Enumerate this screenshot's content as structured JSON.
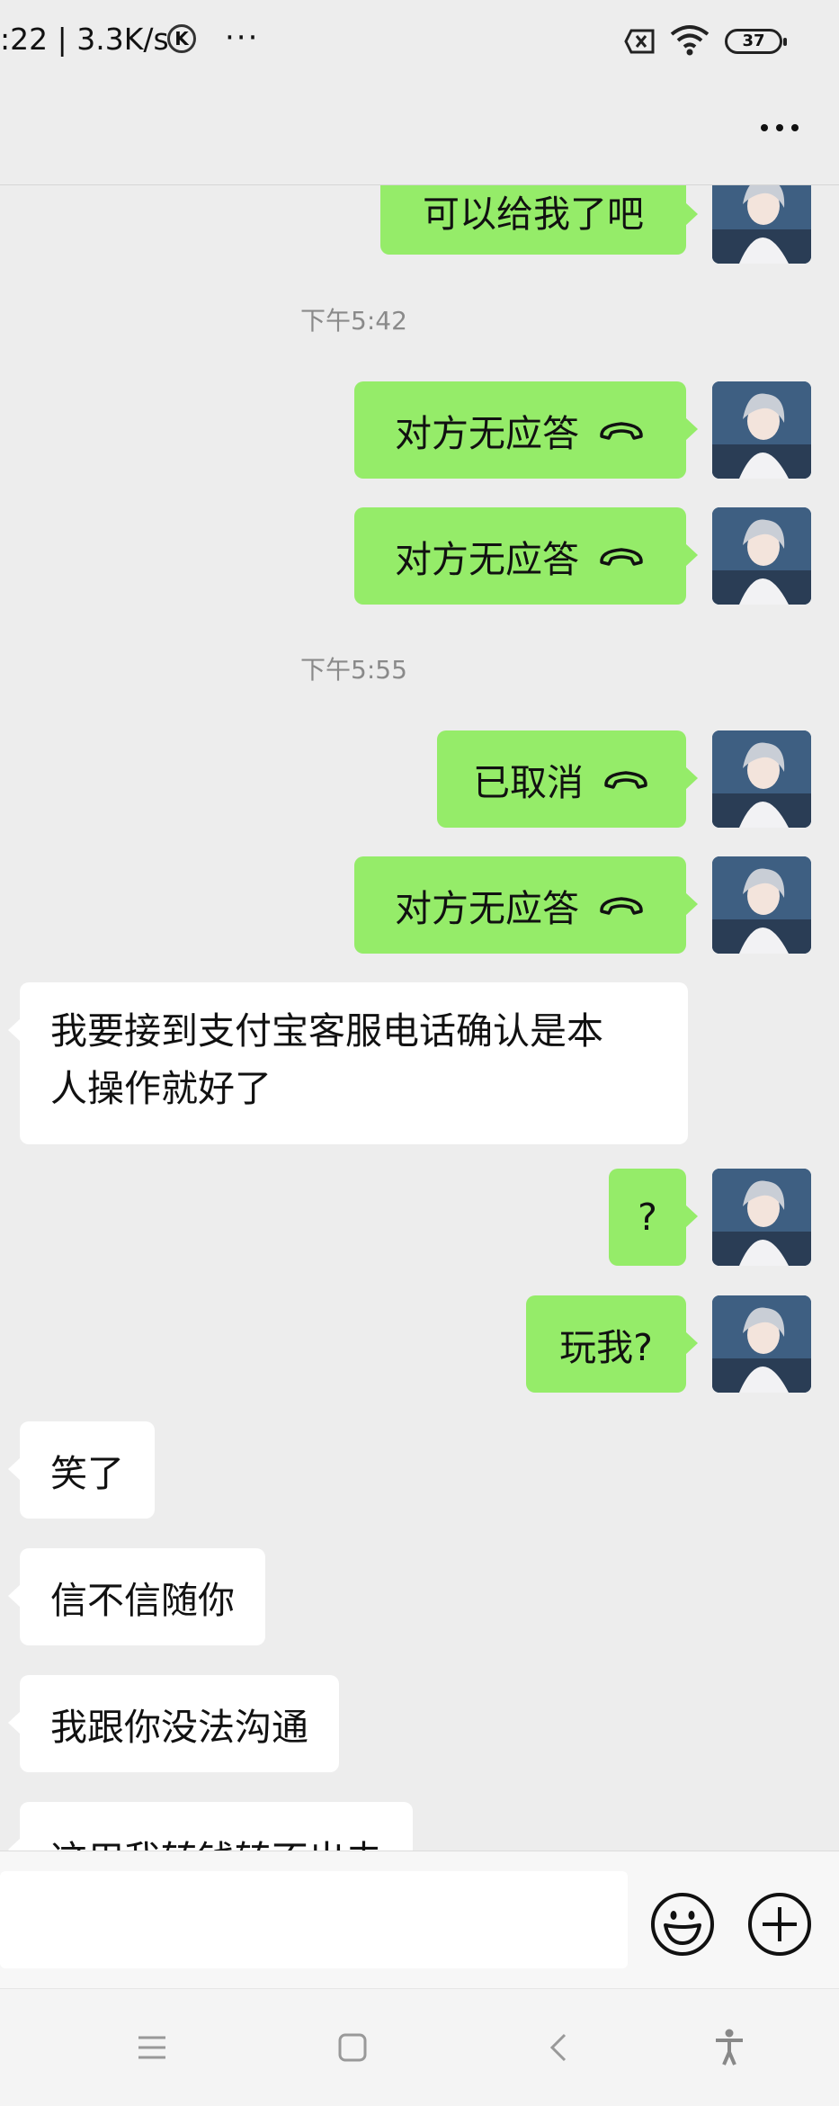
{
  "status_bar": {
    "time_speed": ":22 | 3.3K/s",
    "k_badge": "K",
    "more_dots": "···",
    "battery": "37"
  },
  "chat": {
    "messages": [
      {
        "type": "text",
        "direction": "out",
        "text": "可以给我了吧"
      },
      {
        "type": "timestamp",
        "text": "下午5:42"
      },
      {
        "type": "call",
        "direction": "out",
        "text": "对方无应答",
        "icon": "phone-hangup-icon"
      },
      {
        "type": "call",
        "direction": "out",
        "text": "对方无应答",
        "icon": "phone-hangup-icon"
      },
      {
        "type": "timestamp",
        "text": "下午5:55"
      },
      {
        "type": "call",
        "direction": "out",
        "text": "已取消",
        "icon": "phone-hangup-icon"
      },
      {
        "type": "call",
        "direction": "out",
        "text": "对方无应答",
        "icon": "phone-hangup-icon"
      },
      {
        "type": "text",
        "direction": "in",
        "lines": [
          "我要接到支付宝客服电话确认是本",
          "人操作就好了"
        ]
      },
      {
        "type": "text",
        "direction": "out",
        "text": "?"
      },
      {
        "type": "text",
        "direction": "out",
        "text": "玩我?"
      },
      {
        "type": "text",
        "direction": "in",
        "text": "笑了"
      },
      {
        "type": "text",
        "direction": "in",
        "text": "信不信随你"
      },
      {
        "type": "text",
        "direction": "in",
        "text": "我跟你没法沟通"
      },
      {
        "type": "text",
        "direction": "in",
        "text": "这用我转钱转不出去",
        "partial": true
      }
    ]
  },
  "input_bar": {
    "placeholder": "",
    "emoji_icon": "emoji-smile-icon",
    "plus_icon": "plus-circle-icon"
  },
  "nav_bar": {
    "icons": [
      "menu-icon",
      "home-square-icon",
      "back-chevron-icon",
      "accessibility-icon"
    ]
  },
  "colors": {
    "background": "#ededed",
    "outgoing_bubble": "#95ec69",
    "incoming_bubble": "#ffffff",
    "timestamp_text": "#8a8a8a"
  }
}
